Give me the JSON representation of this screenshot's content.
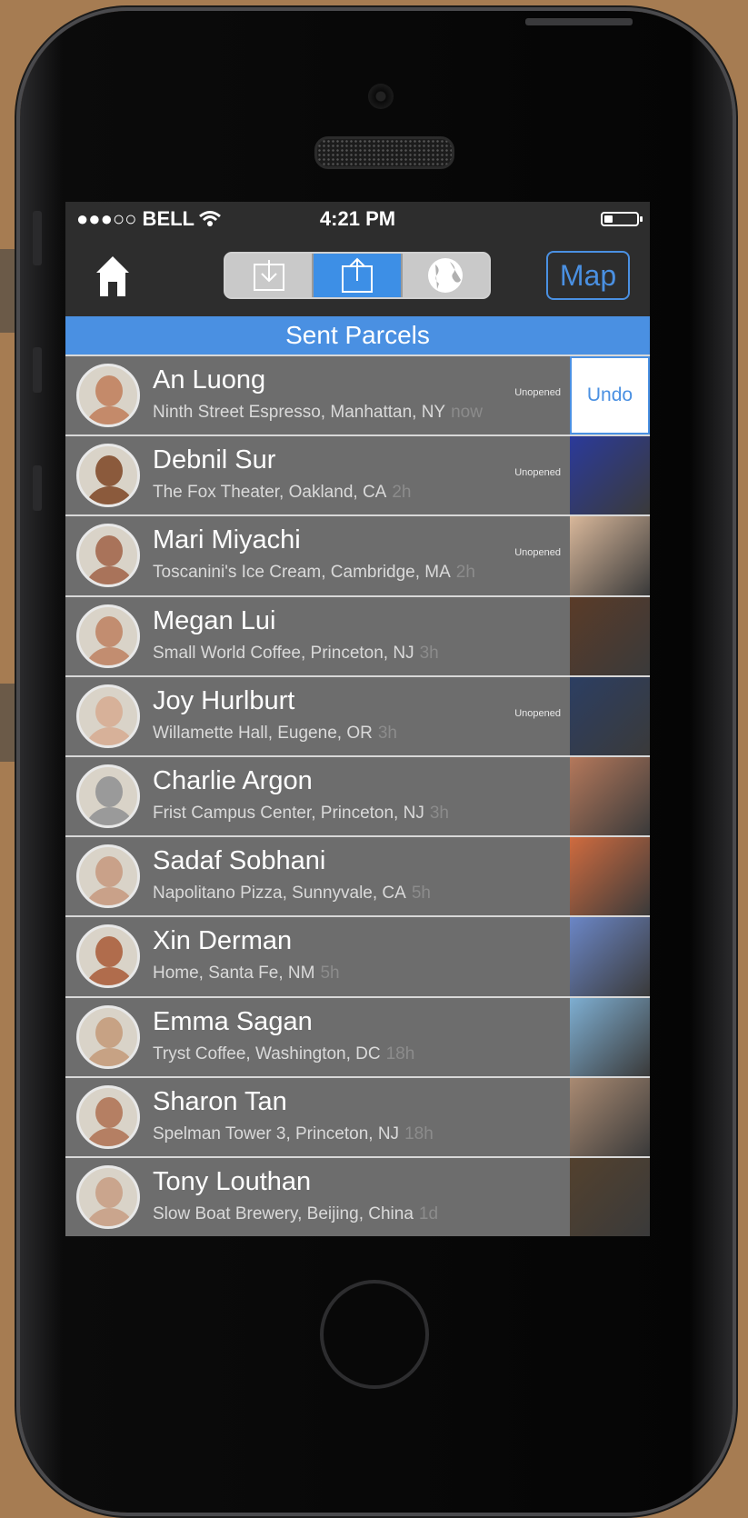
{
  "status_bar": {
    "carrier": "●●●○○ BELL",
    "time": "4:21 PM"
  },
  "nav": {
    "map_label": "Map"
  },
  "section": {
    "title": "Sent Parcels"
  },
  "rows": [
    {
      "name": "An Luong",
      "place": "Ninth Street Espresso, Manhattan, NY",
      "time": "now",
      "status": "Unopened",
      "undo": "Undo",
      "color": "#c48a6a"
    },
    {
      "name": "Debnil Sur",
      "place": "The Fox Theater, Oakland, CA",
      "time": "2h",
      "status": "Unopened",
      "color": "#8b5a3c"
    },
    {
      "name": "Mari Miyachi",
      "place": "Toscanini's Ice Cream, Cambridge, MA",
      "time": "2h",
      "status": "Unopened",
      "color": "#a9735a"
    },
    {
      "name": "Megan Lui",
      "place": "Small World Coffee, Princeton, NJ",
      "time": "3h",
      "status": "",
      "color": "#c28d70"
    },
    {
      "name": "Joy Hurlburt",
      "place": "Willamette Hall, Eugene, OR",
      "time": "3h",
      "status": "Unopened",
      "color": "#d7b199"
    },
    {
      "name": "Charlie Argon",
      "place": "Frist Campus Center, Princeton, NJ",
      "time": "3h",
      "status": "",
      "color": "#9a9a9a"
    },
    {
      "name": "Sadaf Sobhani",
      "place": "Napolitano Pizza, Sunnyvale, CA",
      "time": "5h",
      "status": "",
      "color": "#c9a189"
    },
    {
      "name": "Xin Derman",
      "place": "Home, Santa Fe, NM",
      "time": "5h",
      "status": "",
      "color": "#b06c4c"
    },
    {
      "name": "Emma Sagan",
      "place": "Tryst Coffee, Washington, DC",
      "time": "18h",
      "status": "",
      "color": "#c7a284"
    },
    {
      "name": "Sharon Tan",
      "place": "Spelman Tower 3, Princeton, NJ",
      "time": "18h",
      "status": "",
      "color": "#b57f63"
    },
    {
      "name": "Tony Louthan",
      "place": "Slow Boat Brewery, Beijing, China",
      "time": "1d",
      "status": "",
      "color": "#caa58d"
    }
  ],
  "thumb_colors": [
    "#ffffff",
    "#2b3a9a",
    "#d8b79a",
    "#5a3b28",
    "#2c3e62",
    "#b4785b",
    "#cf6b3f",
    "#6b86c6",
    "#7eaed1",
    "#a98a72",
    "#53412e"
  ],
  "icons": {
    "home": "home-icon",
    "inbox": "download-icon",
    "sent": "upload-icon",
    "world": "globe-icon",
    "wifi": "wifi-icon",
    "battery": "battery-icon"
  }
}
